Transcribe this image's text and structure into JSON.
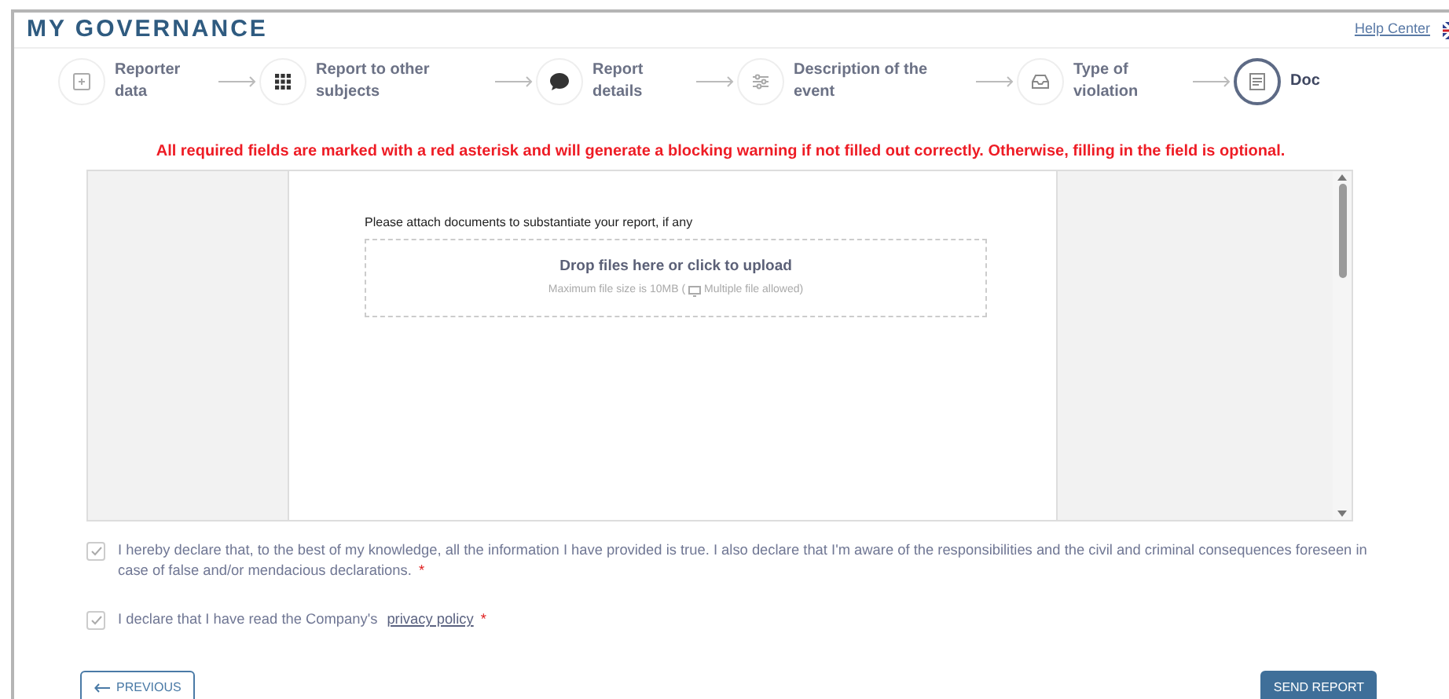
{
  "header": {
    "title": "MY GOVERNANCE",
    "help_link": "Help Center"
  },
  "steps": [
    {
      "label": "Reporter data",
      "selected": false
    },
    {
      "label": "Report to other subjects",
      "selected": false
    },
    {
      "label": "Report details",
      "selected": false
    },
    {
      "label": "Description of the event",
      "selected": false
    },
    {
      "label": "Type of violation",
      "selected": false
    },
    {
      "label": "Doc",
      "selected": true
    }
  ],
  "warning": "All required fields are marked with a red asterisk and will generate a blocking warning if not filled out correctly. Otherwise, filling in the field is optional.",
  "document": {
    "instruction": "Please attach documents to substantiate your report, if any",
    "dropzone_title": "Drop files here or click to upload",
    "dropzone_hint_before": "Maximum file size is 10MB (",
    "dropzone_hint_after": "Multiple file allowed)"
  },
  "declarations": [
    {
      "text": "I hereby declare that, to the best of my knowledge, all the information I have provided is true. I also declare that I'm aware of the responsibilities and the civil and criminal consequences foreseen in case of false and/or mendacious declarations.",
      "required_mark": "*",
      "checked": true
    },
    {
      "text": "I declare that I have read the Company's",
      "link": "privacy policy",
      "required_mark": "*",
      "checked": true
    }
  ],
  "buttons": {
    "previous": "PREVIOUS",
    "send": "SEND REPORT"
  }
}
